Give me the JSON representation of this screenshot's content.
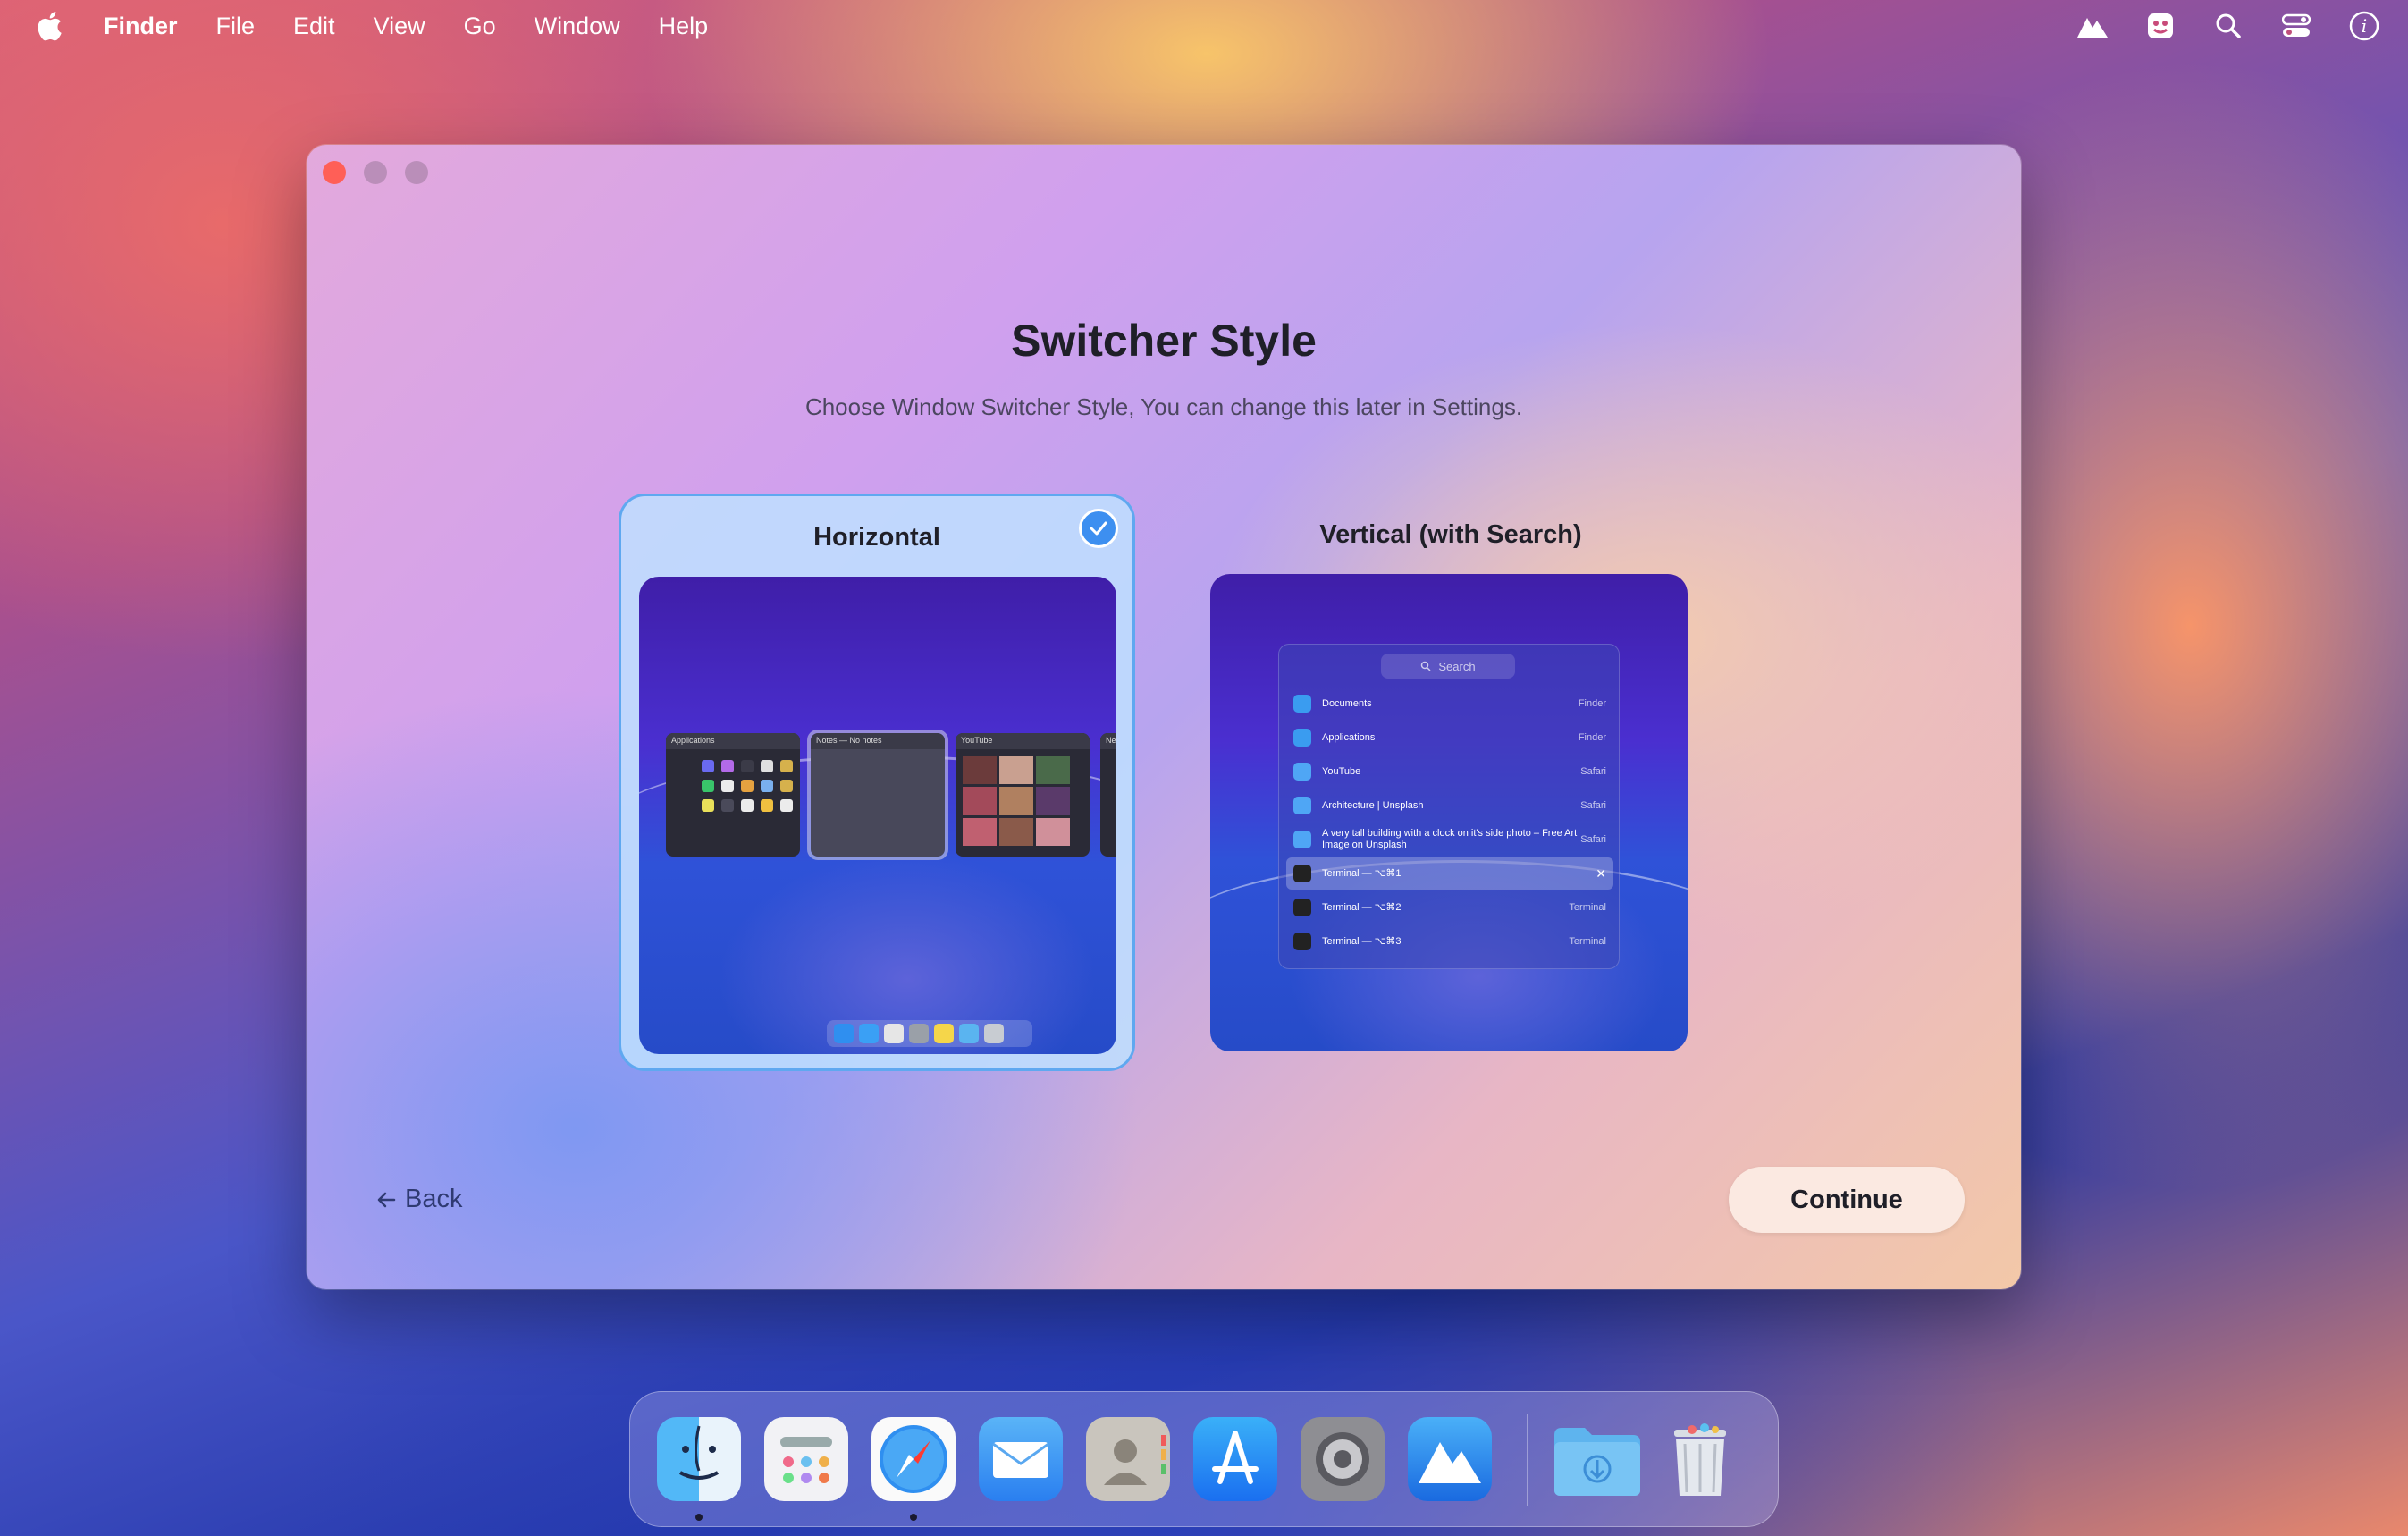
{
  "menubar": {
    "app_name": "Finder",
    "items": [
      "File",
      "Edit",
      "View",
      "Go",
      "Window",
      "Help"
    ]
  },
  "window": {
    "title": "Switcher Style",
    "subtitle": "Choose Window Switcher Style, You can change this later in Settings.",
    "options": [
      {
        "label": "Horizontal",
        "selected": true
      },
      {
        "label": "Vertical (with Search)",
        "selected": false
      }
    ],
    "vertical_preview": {
      "search_placeholder": "Search",
      "rows": [
        {
          "name": "Documents",
          "app": "Finder"
        },
        {
          "name": "Applications",
          "app": "Finder"
        },
        {
          "name": "YouTube",
          "app": "Safari"
        },
        {
          "name": "Architecture | Unsplash",
          "app": "Safari"
        },
        {
          "name": "A very tall building with a clock on it's side photo – Free Art Image on Unsplash",
          "app": "Safari"
        },
        {
          "name": "Terminal — ⌥⌘1",
          "app": ""
        },
        {
          "name": "Terminal — ⌥⌘2",
          "app": "Terminal"
        },
        {
          "name": "Terminal — ⌥⌘3",
          "app": "Terminal"
        }
      ]
    },
    "horizontal_preview": {
      "thumb_titles": [
        "Applications",
        "Notes — No notes",
        "YouTube",
        "New Ta"
      ]
    },
    "back_label": "Back",
    "continue_label": "Continue"
  },
  "dock": {
    "apps": [
      "finder-icon",
      "launchpad-icon",
      "safari-icon",
      "mail-icon",
      "contacts-icon",
      "app-store-icon",
      "system-settings-icon",
      "alttab-icon",
      "downloads-folder-icon",
      "trash-icon"
    ]
  },
  "colors": {
    "accent": "#3d8ff0",
    "close": "#ff5f57"
  }
}
